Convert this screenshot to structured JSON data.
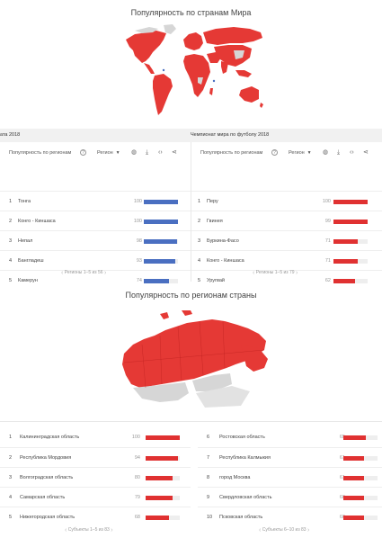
{
  "world": {
    "title": "Популярность по странам Мира"
  },
  "tabs": [
    "ата 2018",
    "Чемпионат мира по футболу 2018"
  ],
  "panel_header": {
    "title": "Популярность по регионам",
    "help": "?",
    "region_select": "Регион"
  },
  "left_panel": {
    "rows": [
      {
        "idx": "1",
        "name": "Тонгa",
        "value": "100",
        "pct": 1.0
      },
      {
        "idx": "2",
        "name": "Конго - Киншаса",
        "value": "100",
        "pct": 1.0
      },
      {
        "idx": "3",
        "name": "Непал",
        "value": "98",
        "pct": 0.98
      },
      {
        "idx": "4",
        "name": "Бангладеш",
        "value": "93",
        "pct": 0.93
      },
      {
        "idx": "5",
        "name": "Камерун",
        "value": "74",
        "pct": 0.74
      }
    ],
    "pager": "Регионы 1–5 из 56"
  },
  "right_panel": {
    "rows": [
      {
        "idx": "1",
        "name": "Перу",
        "value": "100",
        "pct": 1.0
      },
      {
        "idx": "2",
        "name": "Гвинея",
        "value": "99",
        "pct": 0.99
      },
      {
        "idx": "3",
        "name": "Буркина-Фасо",
        "value": "71",
        "pct": 0.71
      },
      {
        "idx": "4",
        "name": "Конго - Киншаса",
        "value": "71",
        "pct": 0.71
      },
      {
        "idx": "5",
        "name": "Уругвай",
        "value": "62",
        "pct": 0.62
      }
    ],
    "pager": "Регионы 1–5 из 79"
  },
  "russia": {
    "title": "Популярность по регионам страны"
  },
  "russia_left": {
    "rows": [
      {
        "idx": "1",
        "name": "Калининградская область",
        "value": "100",
        "pct": 1.0
      },
      {
        "idx": "2",
        "name": "Республика Мордовия",
        "value": "94",
        "pct": 0.94
      },
      {
        "idx": "3",
        "name": "Волгоградская область",
        "value": "80",
        "pct": 0.8
      },
      {
        "idx": "4",
        "name": "Самарская область",
        "value": "79",
        "pct": 0.79
      },
      {
        "idx": "5",
        "name": "Нижегородская область",
        "value": "68",
        "pct": 0.68
      }
    ],
    "pager": "Субъекты 1–5 из 83"
  },
  "russia_right": {
    "rows": [
      {
        "idx": "6",
        "name": "Ростовская область",
        "value": "65",
        "pct": 0.65
      },
      {
        "idx": "7",
        "name": "Республика Калмыкия",
        "value": "61",
        "pct": 0.61
      },
      {
        "idx": "8",
        "name": "город Москва",
        "value": "61",
        "pct": 0.61
      },
      {
        "idx": "9",
        "name": "Свердловская область",
        "value": "60",
        "pct": 0.6
      },
      {
        "idx": "10",
        "name": "Псковская область",
        "value": "60",
        "pct": 0.6
      }
    ],
    "pager": "Субъекты 6–10 из 83"
  },
  "colors": {
    "blue_bar": "#4a6fc1",
    "red_bar": "#e03131",
    "map_red": "#e53935",
    "map_gray": "#d6d6d6"
  },
  "icons": [
    "globe-icon",
    "download-icon",
    "embed-icon",
    "share-icon",
    "chevron-left-icon",
    "chevron-right-icon",
    "help-icon"
  ]
}
